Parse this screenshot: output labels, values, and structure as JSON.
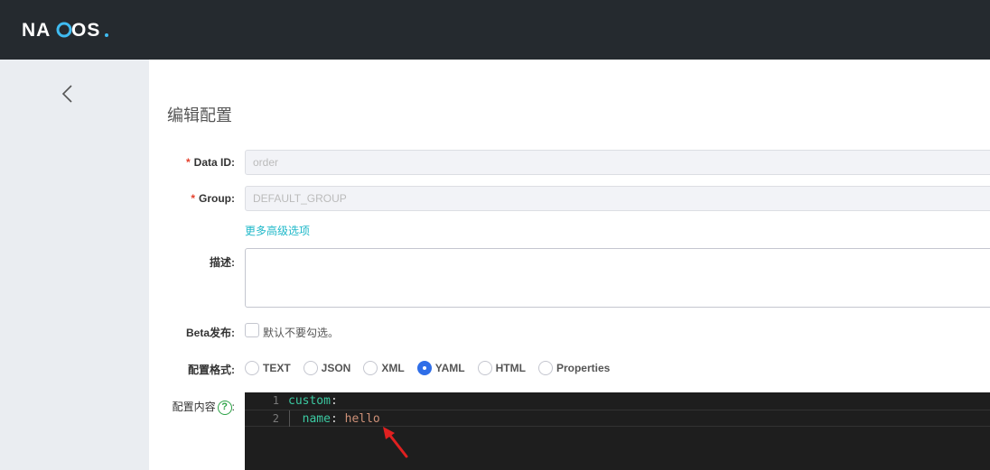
{
  "header": {
    "logo_text": "NACOS."
  },
  "page": {
    "title": "编辑配置"
  },
  "form": {
    "data_id": {
      "label": "Data ID:",
      "value": "order"
    },
    "group": {
      "label": "Group:",
      "value": "DEFAULT_GROUP"
    },
    "advanced_link": "更多高级选项",
    "description": {
      "label": "描述:",
      "value": ""
    },
    "beta": {
      "label": "Beta发布:",
      "checkbox_text": "默认不要勾选。"
    },
    "format": {
      "label": "配置格式:",
      "options": [
        "TEXT",
        "JSON",
        "XML",
        "YAML",
        "HTML",
        "Properties"
      ],
      "selected": "YAML"
    },
    "content": {
      "label": "配置内容",
      "help_icon": "?",
      "colon": ":",
      "lines": [
        {
          "num": "1",
          "key": "custom",
          "sep": ":",
          "value": ""
        },
        {
          "num": "2",
          "key": "  name",
          "sep": ": ",
          "value": "hello"
        }
      ]
    }
  },
  "colors": {
    "accent": "#2f6ee8",
    "link": "#1fb8c9",
    "required": "#e5412d",
    "arrow": "#e02020"
  }
}
